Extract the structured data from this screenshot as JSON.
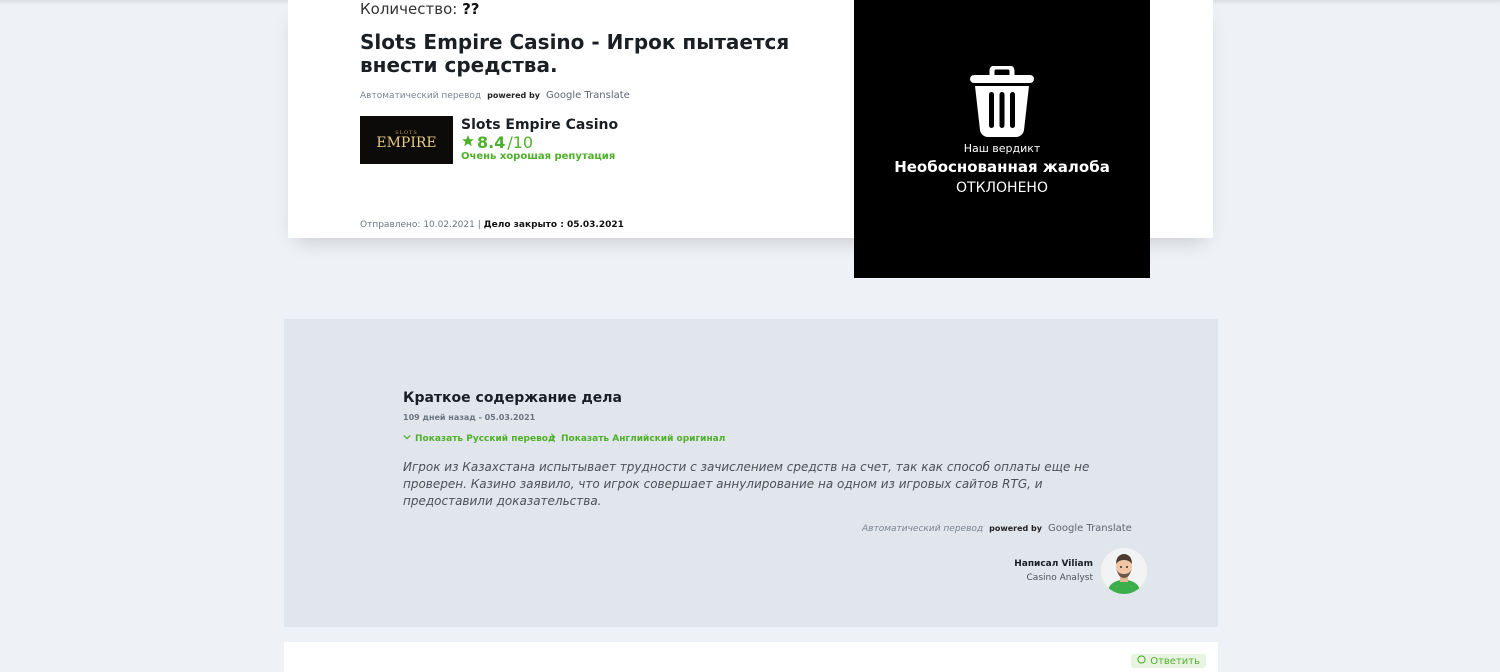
{
  "complaint": {
    "amount_label": "Количество:",
    "amount_value": "??",
    "title": "Slots Empire Casino - Игрок пытается внести средства.",
    "translate": {
      "auto": "Автоматический перевод",
      "powered": "powered by",
      "google": "Google Translate"
    },
    "casino": {
      "logo_small": "SLOTS",
      "logo_big": "EMPIRE",
      "name": "Slots Empire Casino",
      "rating": "8.4",
      "rating_max": "/10",
      "reputation": "Очень хорошая репутация"
    },
    "sent_label": "Отправлено: 10.02.2021",
    "separator": "|",
    "closed_label": "Дело закрыто : 05.03.2021"
  },
  "verdict": {
    "icon": "trash-icon",
    "label": "Наш вердикт",
    "type": "Необоснованная жалоба",
    "status": "ОТКЛОНЕНО"
  },
  "summary": {
    "title": "Краткое содержание дела",
    "date": "109 дней назад - 05.03.2021",
    "show_russian": "Показать Русский перевод",
    "show_english": "Показать Английский оригинал",
    "text": "Игрок из Казахстана испытывает трудности с зачислением средств на счет, так как способ оплаты еще не проверен. Казино заявило, что игрок совершает аннулирование на одном из игровых сайтов RTG, и предоставили доказательства.",
    "translate": {
      "auto": "Автоматический перевод",
      "powered": "powered by",
      "google": "Google Translate"
    },
    "author": "Написал Viliam",
    "author_role": "Casino Analyst"
  },
  "bottom": {
    "responses_label": "Ответить"
  },
  "colors": {
    "accent_green": "#4fb02b",
    "verdict_bg": "#000000",
    "page_bg": "#eef1f5",
    "summary_bg": "#e1e5ec"
  }
}
